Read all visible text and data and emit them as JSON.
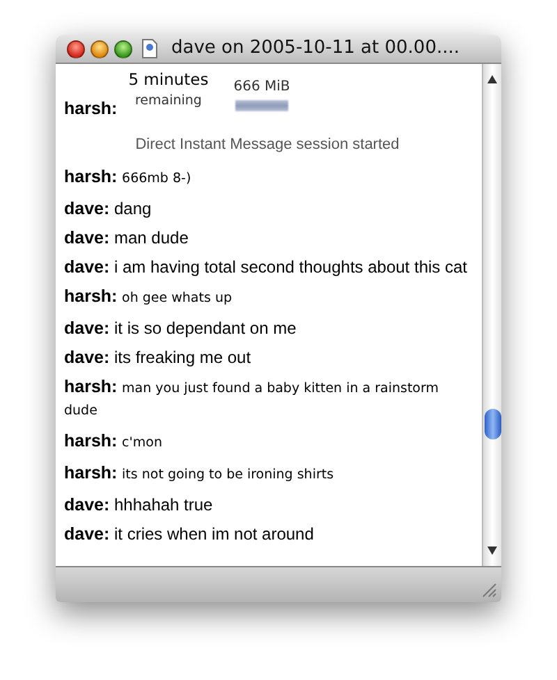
{
  "window": {
    "title": "dave on 2005-10-11 at 00.00...."
  },
  "transfer": {
    "sender": "harsh:",
    "time": "5 minutes",
    "time_note": "remaining",
    "size": "666 MiB"
  },
  "status": "Direct Instant Message session started",
  "messages": [
    {
      "sender": "harsh:",
      "text": "666mb 8-)",
      "kind": "small"
    },
    {
      "sender": "dave:",
      "text": "dang",
      "kind": "normal"
    },
    {
      "sender": "dave:",
      "text": "man dude",
      "kind": "normal"
    },
    {
      "sender": "dave:",
      "text": "i am having total second thoughts about this cat",
      "kind": "normal"
    },
    {
      "sender": "harsh:",
      "text": "oh gee whats up",
      "kind": "small"
    },
    {
      "sender": "dave:",
      "text": "it is so dependant on me",
      "kind": "normal"
    },
    {
      "sender": "dave:",
      "text": "its freaking me out",
      "kind": "normal"
    },
    {
      "sender": "harsh:",
      "text": "man you just found a baby kitten in a rainstorm dude",
      "kind": "small"
    },
    {
      "sender": "harsh:",
      "text": "c'mon",
      "kind": "small"
    },
    {
      "sender": "harsh:",
      "text": "its not going to be ironing shirts",
      "kind": "small"
    },
    {
      "sender": "dave:",
      "text": "hhhahah true",
      "kind": "normal"
    },
    {
      "sender": "dave:",
      "text": "it cries when im not around",
      "kind": "normal"
    }
  ]
}
